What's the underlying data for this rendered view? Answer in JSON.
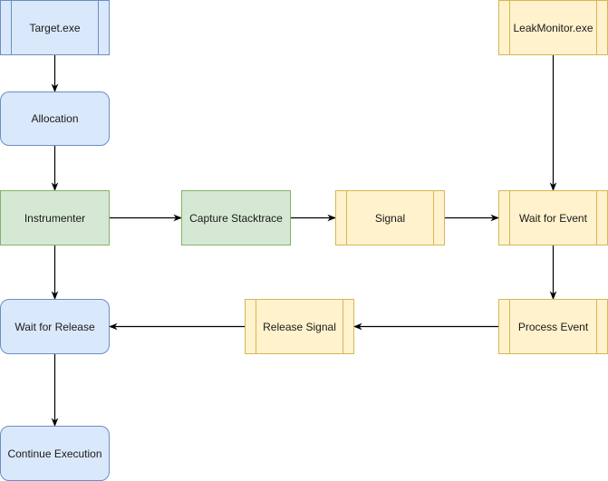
{
  "diagram": {
    "type": "flowchart",
    "colors": {
      "blue_fill": "#dae8fc",
      "blue_stroke": "#6c8ebf",
      "green_fill": "#d5e8d4",
      "green_stroke": "#82b366",
      "yellow_fill": "#fff2cc",
      "yellow_stroke": "#d6b656",
      "edge": "#000000"
    },
    "nodes": [
      {
        "id": "target",
        "label": "Target.exe",
        "shape": "process",
        "color": "blue"
      },
      {
        "id": "allocation",
        "label": "Allocation",
        "shape": "rounded",
        "color": "blue"
      },
      {
        "id": "instrumenter",
        "label": "Instrumenter",
        "shape": "rect",
        "color": "green"
      },
      {
        "id": "capture",
        "label": "Capture Stacktrace",
        "shape": "rect",
        "color": "green"
      },
      {
        "id": "signal",
        "label": "Signal",
        "shape": "process",
        "color": "yellow"
      },
      {
        "id": "leakmonitor",
        "label": "LeakMonitor.exe",
        "shape": "process",
        "color": "yellow"
      },
      {
        "id": "waitevent",
        "label": "Wait for Event",
        "shape": "process",
        "color": "yellow"
      },
      {
        "id": "processevent",
        "label": "Process Event",
        "shape": "process",
        "color": "yellow"
      },
      {
        "id": "releasesignal",
        "label": "Release Signal",
        "shape": "process",
        "color": "yellow"
      },
      {
        "id": "waitrelease",
        "label": "Wait for Release",
        "shape": "rounded",
        "color": "blue"
      },
      {
        "id": "continue",
        "label": "Continue Execution",
        "shape": "rounded",
        "color": "blue"
      }
    ],
    "edges": [
      {
        "from": "target",
        "to": "allocation"
      },
      {
        "from": "allocation",
        "to": "instrumenter"
      },
      {
        "from": "instrumenter",
        "to": "capture"
      },
      {
        "from": "capture",
        "to": "signal"
      },
      {
        "from": "signal",
        "to": "waitevent"
      },
      {
        "from": "leakmonitor",
        "to": "waitevent"
      },
      {
        "from": "waitevent",
        "to": "processevent"
      },
      {
        "from": "processevent",
        "to": "releasesignal"
      },
      {
        "from": "releasesignal",
        "to": "waitrelease"
      },
      {
        "from": "instrumenter",
        "to": "waitrelease"
      },
      {
        "from": "waitrelease",
        "to": "continue"
      }
    ]
  }
}
